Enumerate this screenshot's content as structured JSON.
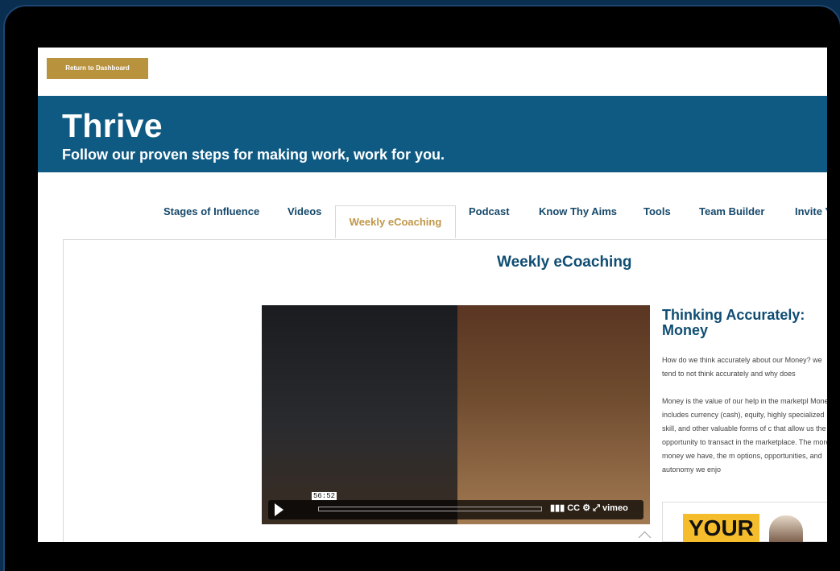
{
  "topbar": {
    "return_label": "Return to Dashboard"
  },
  "hero": {
    "title": "Thrive",
    "subtitle": "Follow our proven steps for making work, work for you."
  },
  "tabs": [
    {
      "label": "Stages of Influence"
    },
    {
      "label": "Videos"
    },
    {
      "label": "Weekly eCoaching",
      "active": true
    },
    {
      "label": "Podcast"
    },
    {
      "label": "Know Thy Aims"
    },
    {
      "label": "Tools"
    },
    {
      "label": "Team Builder"
    },
    {
      "label": "Invite Y"
    }
  ],
  "content": {
    "panel_title": "Weekly eCoaching",
    "video": {
      "time_label": "56:52",
      "provider": "vimeo"
    },
    "article": {
      "title": "Thinking Accurately: Money",
      "paragraphs": [
        "How do we think accurately about our Money? we tend to not think accurately and why does",
        "Money is the value of our help in the marketpl Money includes currency (cash), equity, highly specialized skill, and other valuable forms of c that allow us the opportunity to transact in the marketplace. The more money we have, the m options, opportunities, and autonomy we enjo"
      ]
    },
    "promo": {
      "text": "YOUR"
    }
  },
  "colors": {
    "accent": "#b8923d",
    "brand": "#0f5a83",
    "text_dark": "#0f4d73"
  }
}
